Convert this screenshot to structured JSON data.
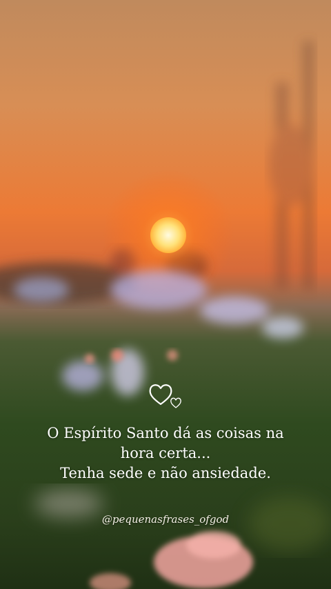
{
  "quote": {
    "line1": "O Espírito Santo dá as coisas na",
    "line2": "hora certa...",
    "line3": "Tenha sede e não ansiedade."
  },
  "handle": "@pequenasfrases_ofgod",
  "decor": {
    "icon": "hearts-icon"
  },
  "colors": {
    "sky_top": "#c48a5b",
    "sun": "#fff2a8",
    "glow": "#ff7a1e",
    "meadow": "#27421a",
    "flower_pink": "#f2a4a0",
    "flower_lilac": "#b9b3e6"
  }
}
